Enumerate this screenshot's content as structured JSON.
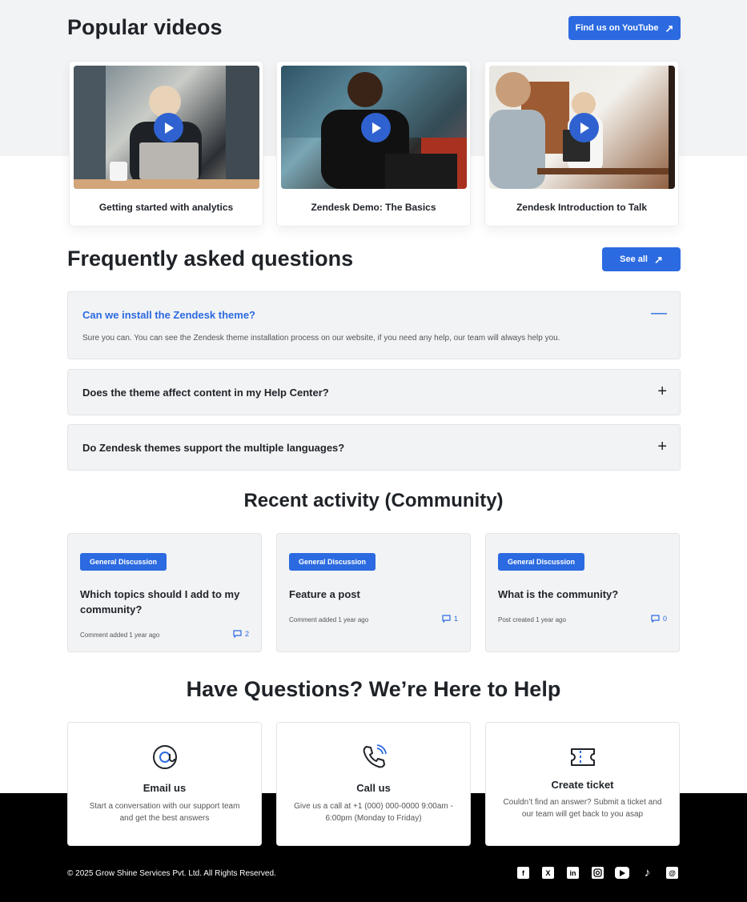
{
  "popular": {
    "title": "Popular videos",
    "youtube_button": "Find us on YouTube",
    "videos": [
      {
        "title": "Getting started with analytics"
      },
      {
        "title": "Zendesk Demo: The Basics"
      },
      {
        "title": "Zendesk Introduction to Talk"
      }
    ]
  },
  "faq": {
    "title": "Frequently asked questions",
    "see_all": "See all",
    "items": [
      {
        "question": "Can we install the Zendesk theme?",
        "answer": "Sure you can. You can see the Zendesk theme installation process on our website, if you need any help, our team will always help you.",
        "expanded": true
      },
      {
        "question": "Does the theme affect content in my Help Center?",
        "expanded": false
      },
      {
        "question": "Do Zendesk themes support the multiple languages?",
        "expanded": false
      }
    ]
  },
  "activity": {
    "title": "Recent activity (Community)",
    "items": [
      {
        "badge": "General Discussion",
        "title": "Which topics should I add to my community?",
        "meta": "Comment added 1 year ago",
        "count": "2"
      },
      {
        "badge": "General Discussion",
        "title": "Feature a post",
        "meta": "Comment added 1 year ago",
        "count": "1"
      },
      {
        "badge": "General Discussion",
        "title": "What is the community?",
        "meta": "Post created 1 year ago",
        "count": "0"
      }
    ]
  },
  "help": {
    "title": "Have Questions? We’re Here to Help",
    "cards": [
      {
        "icon": "at-icon",
        "title": "Email us",
        "desc": "Start a conversation with our support team and get the best answers"
      },
      {
        "icon": "phone-icon",
        "title": "Call us",
        "desc": "Give us a call at +1 (000) 000-0000 9:00am - 6:00pm (Monday to Friday)"
      },
      {
        "icon": "ticket-icon",
        "title": "Create ticket",
        "desc": "Couldn’t find an answer? Submit a ticket and our team will get back to you asap"
      }
    ]
  },
  "footer": {
    "copyright": "© 2025 Grow Shine Services Pvt. Ltd. All Rights Reserved.",
    "social": [
      "facebook-icon",
      "x-icon",
      "linkedin-icon",
      "instagram-icon",
      "youtube-icon",
      "tiktok-icon",
      "threads-icon"
    ]
  },
  "colors": {
    "accent": "#2b6ae0",
    "section_bg": "#f2f3f5",
    "footer_bg": "#000000",
    "text": "#1f2328"
  }
}
